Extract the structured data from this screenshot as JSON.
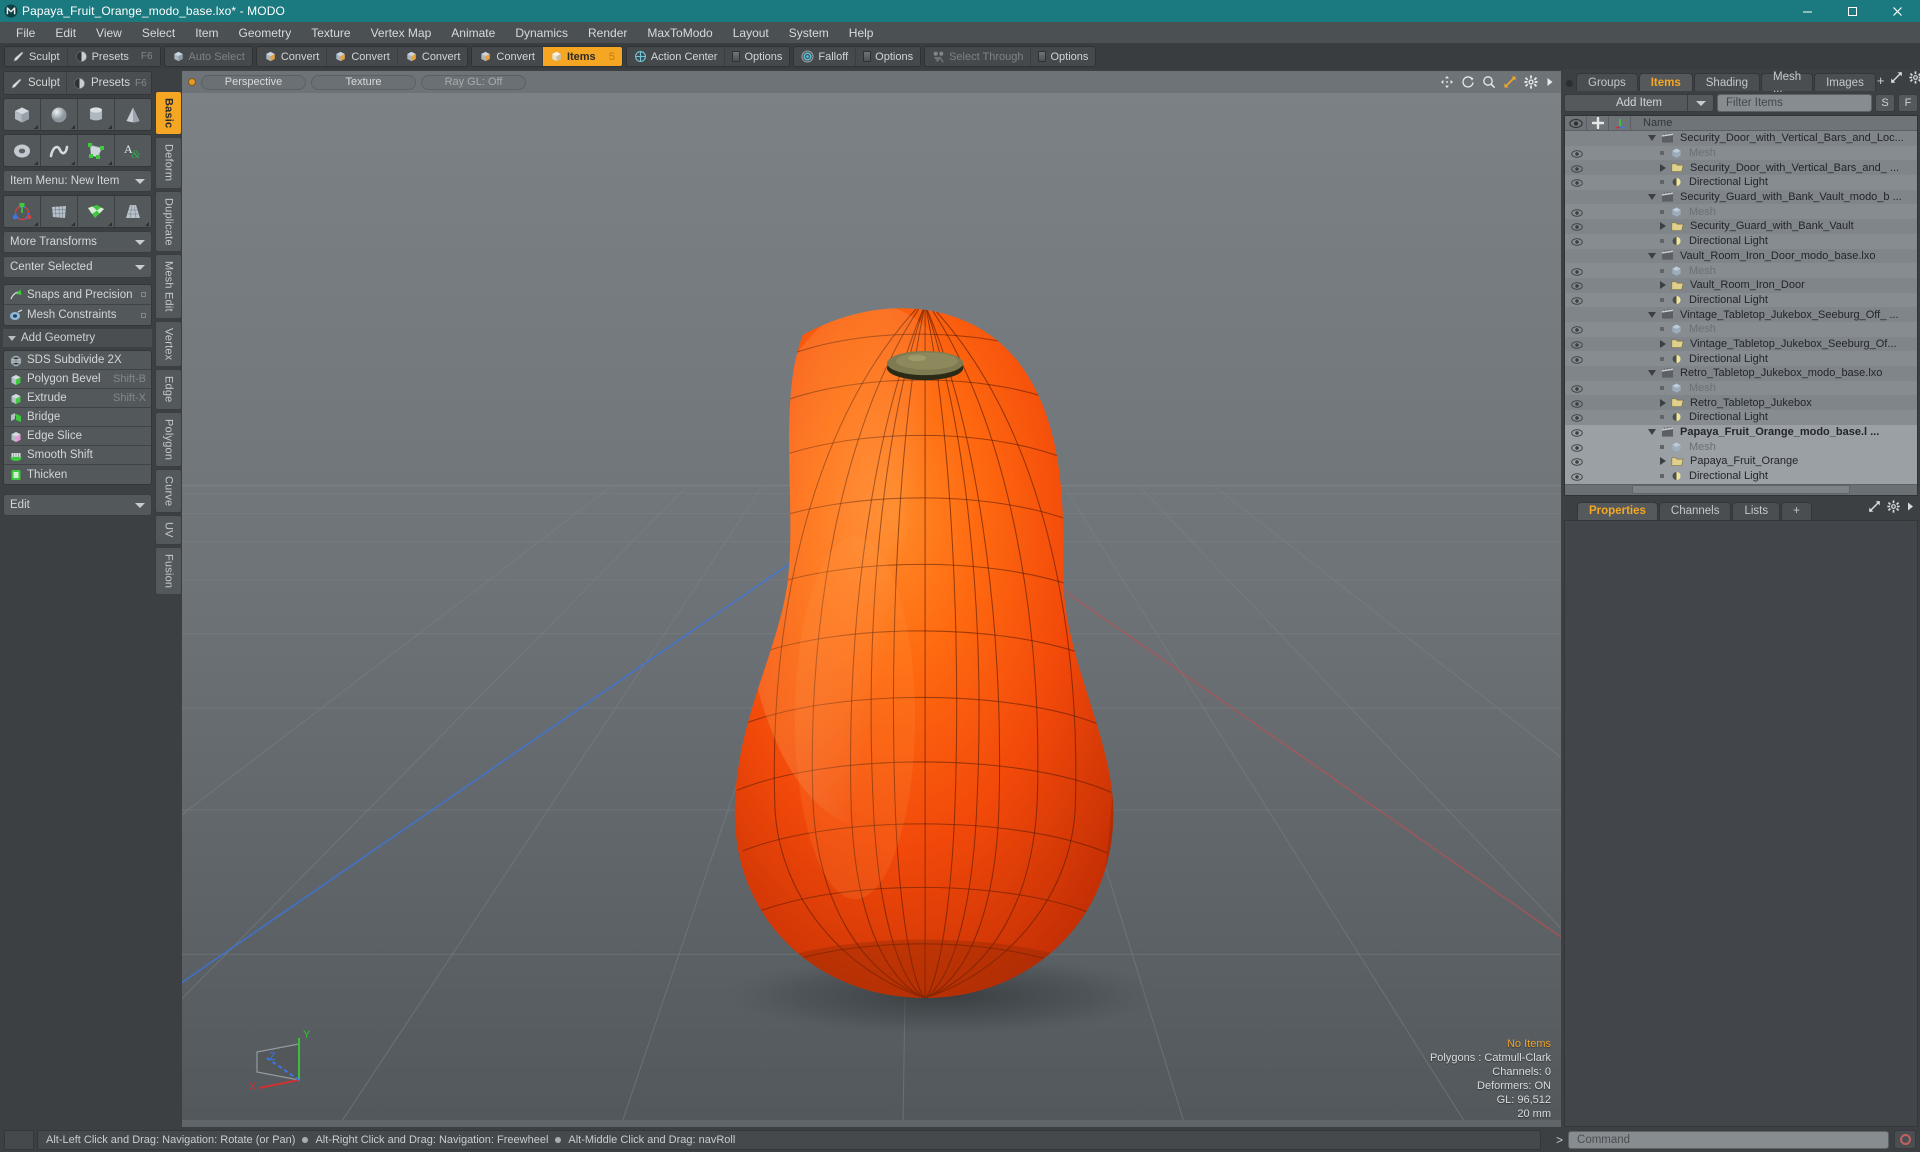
{
  "window": {
    "title": "Papaya_Fruit_Orange_modo_base.lxo* - MODO",
    "logo_icon": "modo-logo-icon",
    "minimize_label": "─",
    "maximize_label": "☐",
    "close_label": "✕",
    "accent_teal": "#1b7a7f",
    "accent_orange": "#f5a623"
  },
  "menubar": {
    "items": [
      {
        "label": "File"
      },
      {
        "label": "Edit"
      },
      {
        "label": "View"
      },
      {
        "label": "Select"
      },
      {
        "label": "Item"
      },
      {
        "label": "Geometry"
      },
      {
        "label": "Texture"
      },
      {
        "label": "Vertex Map"
      },
      {
        "label": "Animate"
      },
      {
        "label": "Dynamics"
      },
      {
        "label": "Render"
      },
      {
        "label": "MaxToModo"
      },
      {
        "label": "Layout"
      },
      {
        "label": "System"
      },
      {
        "label": "Help"
      }
    ]
  },
  "toolbar": {
    "groups": [
      {
        "buttons": [
          {
            "label": "Sculpt",
            "icon": "sculpt-brush-icon",
            "state": "normal"
          },
          {
            "label": "Presets",
            "icon": "sphere-preset-icon",
            "state": "normal",
            "shortcut": "F6"
          }
        ]
      },
      {
        "buttons": [
          {
            "label": "Auto Select",
            "icon": "cube-grey-icon",
            "state": "dim"
          }
        ]
      },
      {
        "buttons": [
          {
            "label": "Convert",
            "icon": "cube-vertex-icon",
            "state": "normal"
          },
          {
            "label": "Convert",
            "icon": "cube-edge-icon",
            "state": "normal"
          },
          {
            "label": "Convert",
            "icon": "cube-polygon-icon",
            "state": "normal"
          }
        ]
      },
      {
        "buttons": [
          {
            "label": "Convert",
            "icon": "cube-item-icon",
            "state": "normal"
          },
          {
            "label": "Items",
            "icon": "items-cube-icon",
            "state": "active",
            "badge": "5"
          }
        ]
      },
      {
        "buttons": [
          {
            "label": "Action Center",
            "icon": "action-center-icon",
            "state": "normal"
          },
          {
            "label": "Options",
            "icon": "options-panel-icon",
            "state": "normal"
          }
        ]
      },
      {
        "buttons": [
          {
            "label": "Falloff",
            "icon": "falloff-target-icon",
            "state": "normal"
          },
          {
            "label": "Options",
            "icon": "options-panel-icon",
            "state": "normal"
          }
        ]
      },
      {
        "buttons": [
          {
            "label": "Select Through",
            "icon": "select-through-icon",
            "state": "dim"
          },
          {
            "label": "Options",
            "icon": "options-panel-icon",
            "state": "normal"
          }
        ]
      }
    ]
  },
  "left_panel": {
    "primitive_row_1": [
      {
        "icon": "cube-primitive-icon",
        "name": "cube"
      },
      {
        "icon": "sphere-primitive-icon",
        "name": "sphere"
      },
      {
        "icon": "cylinder-primitive-icon",
        "name": "cylinder"
      },
      {
        "icon": "cone-primitive-icon",
        "name": "cone"
      }
    ],
    "primitive_row_2": [
      {
        "icon": "torus-primitive-icon",
        "name": "torus"
      },
      {
        "icon": "curve-primitive-icon",
        "name": "curve"
      },
      {
        "icon": "polygon-pen-icon",
        "name": "polygon-pen"
      },
      {
        "icon": "text-tool-icon",
        "name": "text"
      }
    ],
    "item_menu_label": "Item Menu: New Item",
    "transform_row": [
      {
        "icon": "transform-gizmo-icon",
        "name": "transform"
      },
      {
        "icon": "bend-grid-icon",
        "name": "bend"
      },
      {
        "icon": "checker-deform-icon",
        "name": "deform"
      },
      {
        "icon": "taper-grid-icon",
        "name": "taper"
      }
    ],
    "more_transforms_label": "More Transforms",
    "center_selected_label": "Center Selected",
    "snaps_label": "Snaps and Precision",
    "mesh_constraints_label": "Mesh Constraints",
    "add_geometry_label": "Add Geometry",
    "geometry_items": [
      {
        "label": "SDS Subdivide 2X",
        "shortcut": "",
        "icon": "sds-subdivide-icon"
      },
      {
        "label": "Polygon Bevel",
        "shortcut": "Shift-B",
        "icon": "polygon-bevel-icon"
      },
      {
        "label": "Extrude",
        "shortcut": "Shift-X",
        "icon": "extrude-icon"
      },
      {
        "label": "Bridge",
        "shortcut": "",
        "icon": "bridge-icon"
      },
      {
        "label": "Edge Slice",
        "shortcut": "",
        "icon": "edge-slice-icon"
      },
      {
        "label": "Smooth Shift",
        "shortcut": "",
        "icon": "smooth-shift-icon"
      },
      {
        "label": "Thicken",
        "shortcut": "",
        "icon": "thicken-icon"
      }
    ],
    "edit_label": "Edit",
    "vertical_tabs": [
      {
        "label": "Basic",
        "active": true
      },
      {
        "label": "Deform",
        "active": false
      },
      {
        "label": "Duplicate",
        "active": false
      },
      {
        "label": "Mesh Edit",
        "active": false
      },
      {
        "label": "Vertex",
        "active": false
      },
      {
        "label": "Edge",
        "active": false
      },
      {
        "label": "Polygon",
        "active": false
      },
      {
        "label": "Curve",
        "active": false
      },
      {
        "label": "UV",
        "active": false
      },
      {
        "label": "Fusion",
        "active": false
      }
    ]
  },
  "viewport": {
    "tabs": [
      {
        "label": "Perspective"
      },
      {
        "label": "Texture"
      },
      {
        "label": "Ray GL: Off"
      }
    ],
    "header_icons": [
      {
        "name": "move-viewport-icon"
      },
      {
        "name": "rotate-viewport-icon"
      },
      {
        "name": "zoom-viewport-icon"
      },
      {
        "name": "fit-viewport-icon"
      },
      {
        "name": "gear-icon"
      },
      {
        "name": "chevron-right-icon"
      }
    ],
    "info": {
      "line1": "No Items",
      "line2": "Polygons : Catmull-Clark",
      "line3": "Channels: 0",
      "line4": "Deformers: ON",
      "line5": "GL: 96,512",
      "line6": "20 mm"
    },
    "gizmo": {
      "x_label": "X",
      "y_label": "Y",
      "z_label": "Z",
      "x_color": "#cf3030",
      "y_color": "#39c039",
      "z_color": "#3a76e8"
    },
    "model": {
      "name": "Papaya_Fruit_Orange",
      "body_color": "#f24e0c",
      "highlight_color": "#ff7a22",
      "stem_color": "#7e7a52"
    }
  },
  "right_panel": {
    "top_tabs": [
      {
        "label": "Groups",
        "active": false
      },
      {
        "label": "Items",
        "active": true
      },
      {
        "label": "Shading",
        "active": false
      },
      {
        "label": "Mesh ...",
        "active": false
      },
      {
        "label": "Images",
        "active": false
      }
    ],
    "top_tabs_extra": [
      {
        "name": "add-tab-icon",
        "label": "+"
      },
      {
        "name": "expand-icon"
      },
      {
        "name": "gear-icon"
      },
      {
        "name": "chevron-right-icon"
      }
    ],
    "add_item_label": "Add Item",
    "filter_placeholder": "Filter Items",
    "filter_value": "",
    "btn_s_label": "S",
    "btn_f_label": "F",
    "list_headers": {
      "eye": "visibility-column",
      "lock": "lock-column",
      "axis": "axis-column",
      "name": "Name"
    },
    "items": [
      {
        "label": "Security_Door_with_Vertical_Bars_and_Loc...",
        "icon": "scene-clapper-icon",
        "depth": 0,
        "expander": "open",
        "eye": false,
        "dim": false,
        "bold": false,
        "selected": false
      },
      {
        "label": "Mesh",
        "icon": "mesh-cube-icon",
        "depth": 1,
        "expander": "dot",
        "eye": true,
        "dim": true,
        "bold": false,
        "selected": false
      },
      {
        "label": "Security_Door_with_Vertical_Bars_and_ ...",
        "icon": "mesh-folder-icon",
        "depth": 1,
        "expander": "closed",
        "eye": true,
        "dim": false,
        "bold": false,
        "selected": false
      },
      {
        "label": "Directional Light",
        "icon": "light-icon",
        "depth": 1,
        "expander": "dot",
        "eye": true,
        "dim": false,
        "bold": false,
        "selected": false
      },
      {
        "label": "Security_Guard_with_Bank_Vault_modo_b ...",
        "icon": "scene-clapper-icon",
        "depth": 0,
        "expander": "open",
        "eye": false,
        "dim": false,
        "bold": false,
        "selected": false
      },
      {
        "label": "Mesh",
        "icon": "mesh-cube-icon",
        "depth": 1,
        "expander": "dot",
        "eye": true,
        "dim": true,
        "bold": false,
        "selected": false
      },
      {
        "label": "Security_Guard_with_Bank_Vault",
        "icon": "mesh-folder-icon",
        "depth": 1,
        "expander": "closed",
        "eye": true,
        "dim": false,
        "bold": false,
        "selected": false
      },
      {
        "label": "Directional Light",
        "icon": "light-icon",
        "depth": 1,
        "expander": "dot",
        "eye": true,
        "dim": false,
        "bold": false,
        "selected": false
      },
      {
        "label": "Vault_Room_Iron_Door_modo_base.lxo",
        "icon": "scene-clapper-icon",
        "depth": 0,
        "expander": "open",
        "eye": false,
        "dim": false,
        "bold": false,
        "selected": false
      },
      {
        "label": "Mesh",
        "icon": "mesh-cube-icon",
        "depth": 1,
        "expander": "dot",
        "eye": true,
        "dim": true,
        "bold": false,
        "selected": false
      },
      {
        "label": "Vault_Room_Iron_Door",
        "icon": "mesh-folder-icon",
        "depth": 1,
        "expander": "closed",
        "eye": true,
        "dim": false,
        "bold": false,
        "selected": false
      },
      {
        "label": "Directional Light",
        "icon": "light-icon",
        "depth": 1,
        "expander": "dot",
        "eye": true,
        "dim": false,
        "bold": false,
        "selected": false
      },
      {
        "label": "Vintage_Tabletop_Jukebox_Seeburg_Off_ ...",
        "icon": "scene-clapper-icon",
        "depth": 0,
        "expander": "open",
        "eye": false,
        "dim": false,
        "bold": false,
        "selected": false
      },
      {
        "label": "Mesh",
        "icon": "mesh-cube-icon",
        "depth": 1,
        "expander": "dot",
        "eye": true,
        "dim": true,
        "bold": false,
        "selected": false
      },
      {
        "label": "Vintage_Tabletop_Jukebox_Seeburg_Of...",
        "icon": "mesh-folder-icon",
        "depth": 1,
        "expander": "closed",
        "eye": true,
        "dim": false,
        "bold": false,
        "selected": false
      },
      {
        "label": "Directional Light",
        "icon": "light-icon",
        "depth": 1,
        "expander": "dot",
        "eye": true,
        "dim": false,
        "bold": false,
        "selected": false
      },
      {
        "label": "Retro_Tabletop_Jukebox_modo_base.lxo",
        "icon": "scene-clapper-icon",
        "depth": 0,
        "expander": "open",
        "eye": false,
        "dim": false,
        "bold": false,
        "selected": false
      },
      {
        "label": "Mesh",
        "icon": "mesh-cube-icon",
        "depth": 1,
        "expander": "dot",
        "eye": true,
        "dim": true,
        "bold": false,
        "selected": false
      },
      {
        "label": "Retro_Tabletop_Jukebox",
        "icon": "mesh-folder-icon",
        "depth": 1,
        "expander": "closed",
        "eye": true,
        "dim": false,
        "bold": false,
        "selected": false
      },
      {
        "label": "Directional Light",
        "icon": "light-icon",
        "depth": 1,
        "expander": "dot",
        "eye": true,
        "dim": false,
        "bold": false,
        "selected": false
      },
      {
        "label": "Papaya_Fruit_Orange_modo_base.l ...",
        "icon": "scene-clapper-icon",
        "depth": 0,
        "expander": "open",
        "eye": true,
        "dim": false,
        "bold": true,
        "selected": true
      },
      {
        "label": "Mesh",
        "icon": "mesh-cube-icon",
        "depth": 1,
        "expander": "dot",
        "eye": true,
        "dim": true,
        "bold": false,
        "selected": true
      },
      {
        "label": "Papaya_Fruit_Orange",
        "icon": "mesh-folder-icon",
        "depth": 1,
        "expander": "closed",
        "eye": true,
        "dim": false,
        "bold": false,
        "selected": true
      },
      {
        "label": "Directional Light",
        "icon": "light-icon",
        "depth": 1,
        "expander": "dot",
        "eye": true,
        "dim": false,
        "bold": false,
        "selected": true
      }
    ],
    "bottom_tabs": [
      {
        "label": "Properties",
        "active": true
      },
      {
        "label": "Channels",
        "active": false
      },
      {
        "label": "Lists",
        "active": false
      },
      {
        "label": "+",
        "active": false
      }
    ]
  },
  "statusbar": {
    "hint_1": "Alt-Left Click and Drag: Navigation: Rotate (or Pan)",
    "hint_2": "Alt-Right Click and Drag: Navigation: Freewheel",
    "hint_3": "Alt-Middle Click and Drag: navRoll",
    "command_prompt": ">",
    "command_placeholder": "Command",
    "command_value": "",
    "record_icon": "record-circle-icon"
  }
}
